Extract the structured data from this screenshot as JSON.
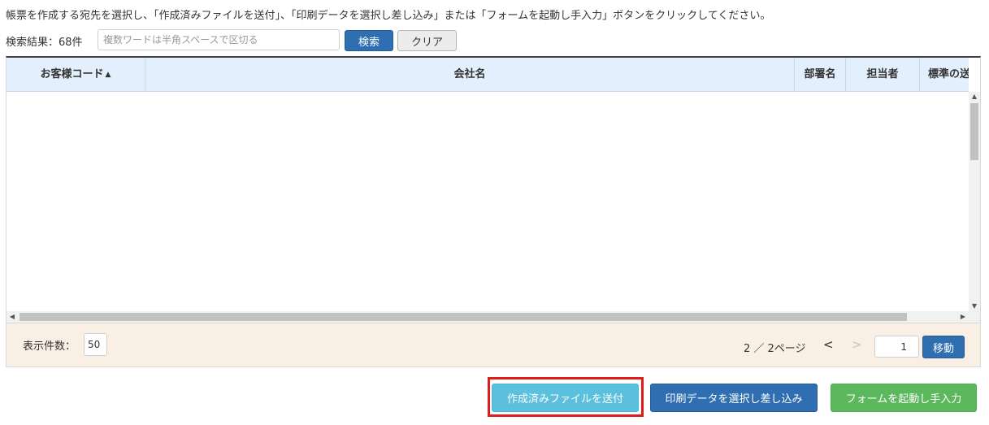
{
  "instruction": "帳票を作成する宛先を選択し、「作成済みファイルを送付」、「印刷データを選択し差し込み」または「フォームを起動し手入力」ボタンをクリックしてください。",
  "search": {
    "result_label": "検索結果：68件",
    "placeholder": "複数ワードは半角スペースで区切る",
    "value": "",
    "search_label": "検索",
    "clear_label": "クリア"
  },
  "table": {
    "columns": [
      {
        "label": "お客様コード",
        "sorted": "asc",
        "sort_icon": "triangle-up-icon"
      },
      {
        "label": "会社名"
      },
      {
        "label": "部署名"
      },
      {
        "label": "担当者"
      },
      {
        "label": "標準の送"
      }
    ],
    "rows": []
  },
  "footer": {
    "per_page_label": "表示件数：",
    "per_page_value": "50",
    "page_info": "2 ／ 2ページ",
    "prev_label": "<",
    "next_label": ">",
    "page_input_value": "1",
    "move_label": "移動"
  },
  "actions": {
    "send_created_file": "作成済みファイルを送付",
    "select_print_data": "印刷データを選択し差し込み",
    "launch_form": "フォームを起動し手入力"
  },
  "colors": {
    "primary": "#2f6fb1",
    "info": "#5bc0de",
    "success": "#5cb85c",
    "highlight": "#e01b1b",
    "header_bg": "#e3effc",
    "footer_bg": "#f9efe4"
  }
}
